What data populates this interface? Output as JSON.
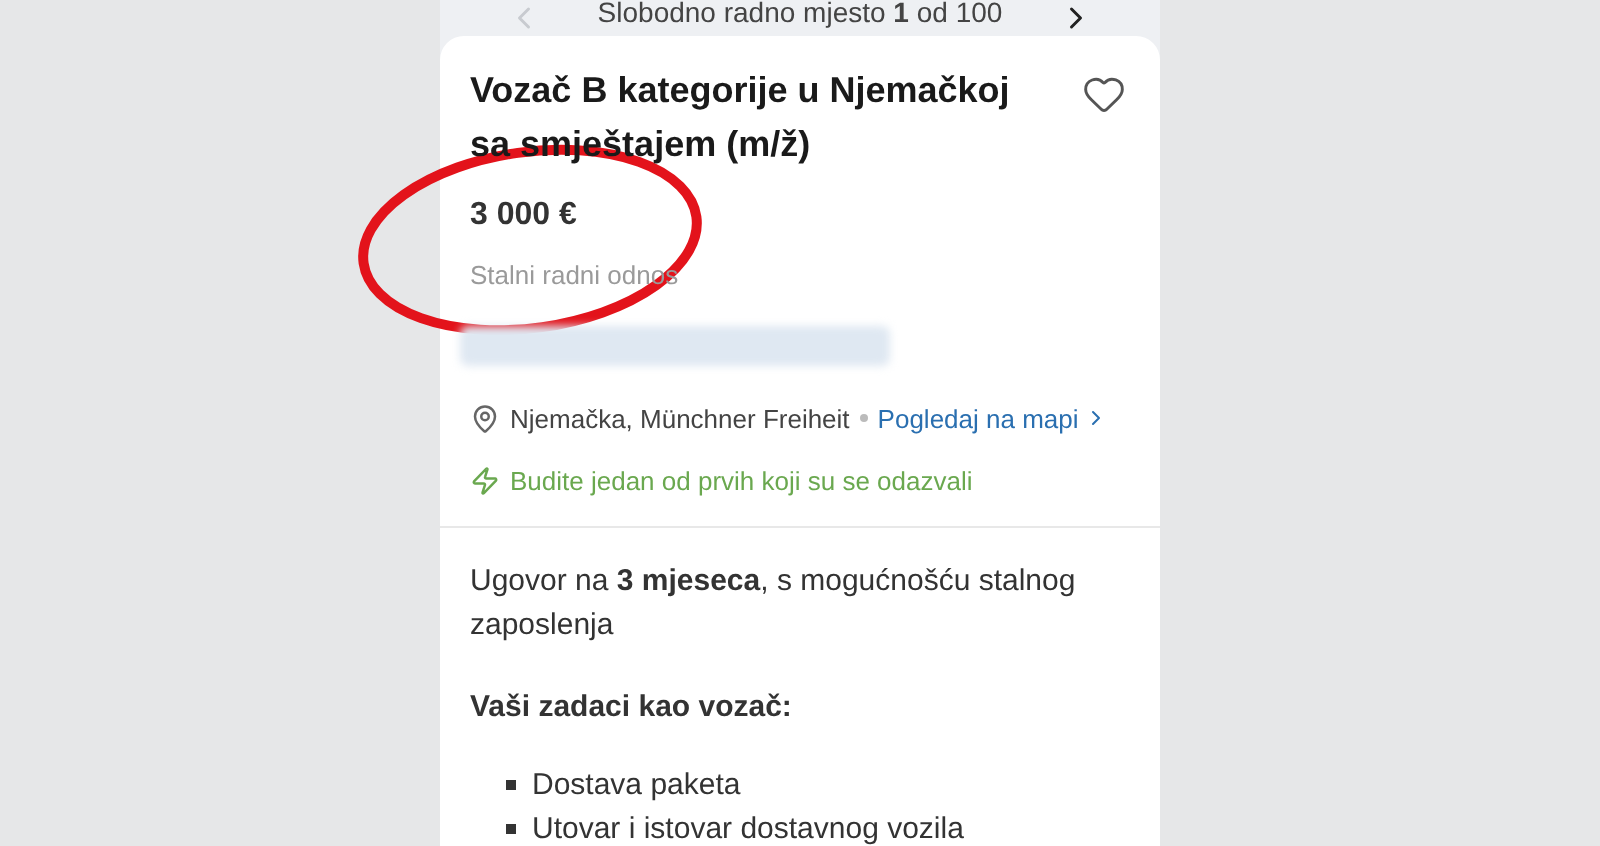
{
  "pager": {
    "text": "Slobodno radno mjesto **1** od 100",
    "prev_disabled": true,
    "next_disabled": false
  },
  "job": {
    "title": "Vozač B kategorije u Njemačkoj sa smještajem (m/ž)",
    "salary": "3 000 €",
    "employment_type": "Stalni radni odnos",
    "location": "Njemačka, Münchner Freiheit",
    "map_link": "Pogledaj na mapi",
    "notice": "Budite jedan od prvih koji su se odazvali"
  },
  "description": {
    "intro": "Ugovor na **3 mjeseca**, s mogućnošću stalnog zaposlenja",
    "heading": "Vaši zadaci kao vozač:",
    "tasks": [
      "Dostava paketa",
      "Utovar i istovar dostavnog vozila"
    ]
  }
}
